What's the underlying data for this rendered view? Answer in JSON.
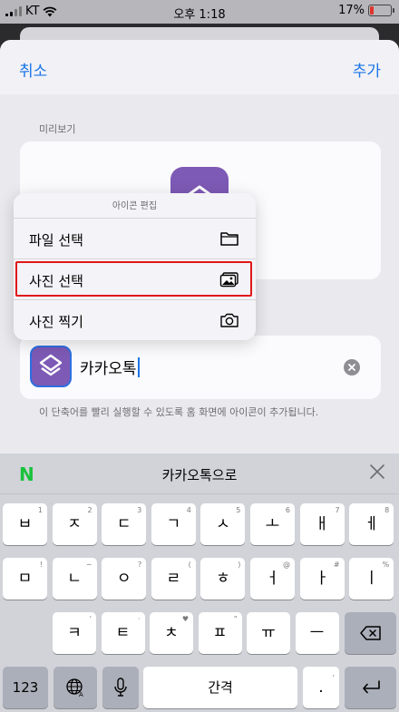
{
  "status_bar": {
    "carrier": "KT",
    "time": "오후 1:18",
    "battery": "17%",
    "battery_level": 0.17
  },
  "nav": {
    "cancel": "취소",
    "add": "추가"
  },
  "preview": {
    "label": "미리보기"
  },
  "context_menu": {
    "header": "아이콘 편집",
    "items": [
      {
        "label": "파일 선택",
        "icon": "folder-icon"
      },
      {
        "label": "사진 선택",
        "icon": "photos-icon",
        "highlighted": true
      },
      {
        "label": "사진 찍기",
        "icon": "camera-icon"
      }
    ]
  },
  "name_field": {
    "value": "카카오톡"
  },
  "hint": "이 단축어를 빨리 실행할 수 있도록 홈 화면에 아이콘이 추가됩니다.",
  "suggestion": {
    "logo": "N",
    "text": "카카오톡으로"
  },
  "keyboard": {
    "row1": [
      {
        "k": "ㅂ",
        "s": "1"
      },
      {
        "k": "ㅈ",
        "s": "2"
      },
      {
        "k": "ㄷ",
        "s": "3"
      },
      {
        "k": "ㄱ",
        "s": "4"
      },
      {
        "k": "ㅅ",
        "s": "5"
      },
      {
        "k": "ㅗ",
        "s": "6"
      },
      {
        "k": "ㅐ",
        "s": "7"
      },
      {
        "k": "ㅔ",
        "s": "8"
      }
    ],
    "row2": [
      {
        "k": "ㅁ",
        "s": "!"
      },
      {
        "k": "ㄴ",
        "s": "~"
      },
      {
        "k": "ㅇ",
        "s": "?"
      },
      {
        "k": "ㄹ",
        "s": "("
      },
      {
        "k": "ㅎ",
        "s": ")"
      },
      {
        "k": "ㅓ",
        "s": "@"
      },
      {
        "k": "ㅏ",
        "s": "#"
      },
      {
        "k": "ㅣ",
        "s": "%"
      }
    ],
    "row3": [
      {
        "k": "ㅋ",
        "s": "'"
      },
      {
        "k": "ㅌ",
        "s": "·"
      },
      {
        "k": "ㅊ",
        "s": "♥"
      },
      {
        "k": "ㅍ",
        "s": "\""
      },
      {
        "k": "ㅠ",
        "s": ""
      },
      {
        "k": "ㅡ",
        "s": ""
      }
    ],
    "numbers_key": "123",
    "space": "간격",
    "period": ".",
    "period_sub": ","
  }
}
